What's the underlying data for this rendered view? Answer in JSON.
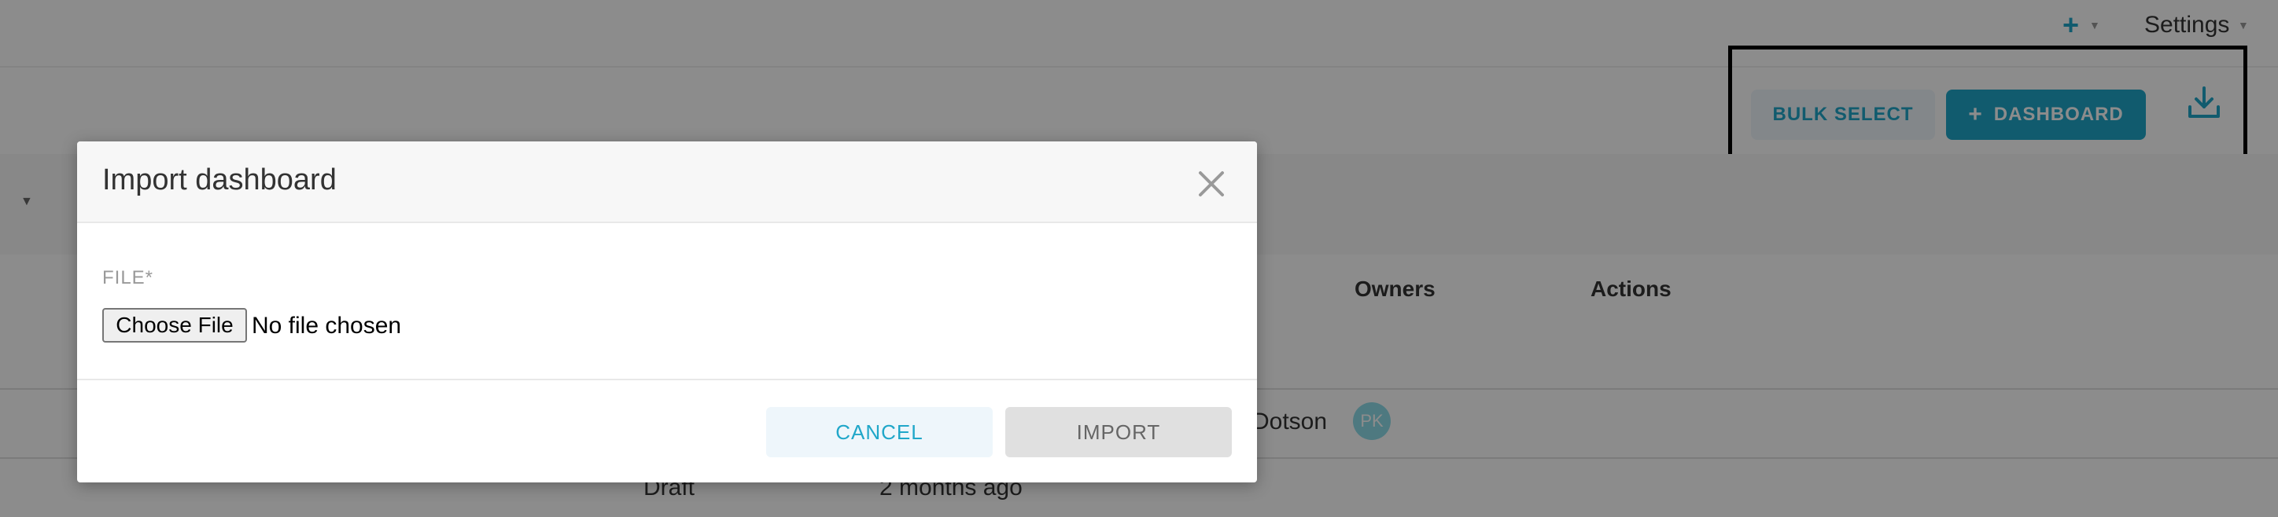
{
  "topbar": {
    "add_icon": "plus-icon",
    "settings_label": "Settings"
  },
  "toolbar": {
    "bulk_select_label": "BULK SELECT",
    "add_dashboard_label": "DASHBOARD",
    "add_dashboard_icon": "plus-icon",
    "download_icon": "download-icon"
  },
  "table": {
    "columns": [
      "Owners",
      "Actions"
    ],
    "rows": [
      {
        "owner_name": "Dotson",
        "owner_initials": "PK"
      },
      {
        "status": "Draft",
        "modified": "2 months ago"
      }
    ]
  },
  "modal": {
    "title": "Import dashboard",
    "close_icon": "close-icon",
    "field_label": "FILE*",
    "choose_file_label": "Choose File",
    "no_file_text": "No file chosen",
    "cancel_label": "CANCEL",
    "import_label": "IMPORT"
  },
  "colors": {
    "accent": "#20a7c9",
    "accent_light": "#eef6fb",
    "overlay": "rgba(0,0,0,0.45)"
  }
}
